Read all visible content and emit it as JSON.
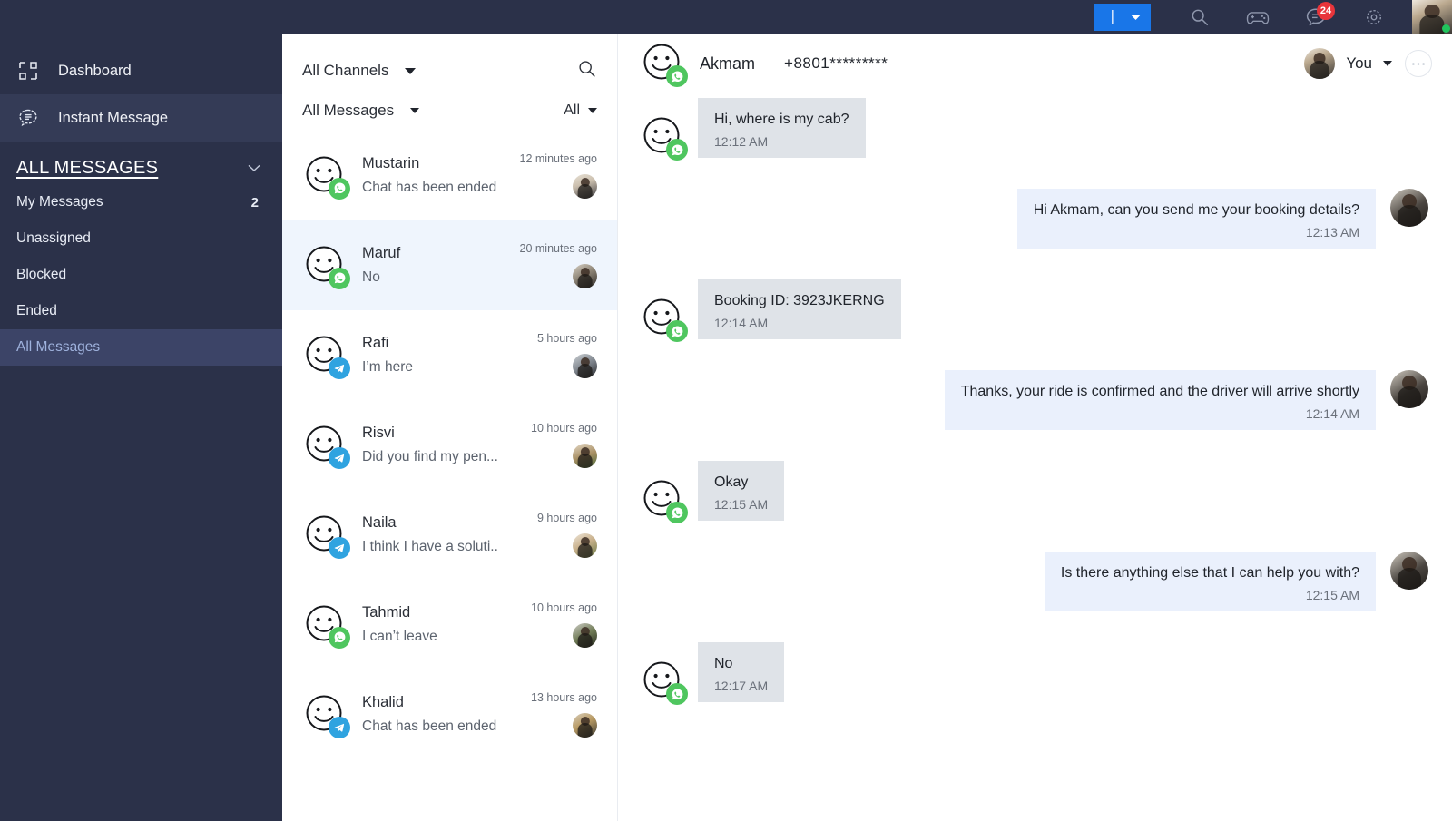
{
  "topbar": {
    "compose_button_label": "",
    "icons": [
      {
        "name": "search-icon",
        "glyph": "search"
      },
      {
        "name": "game-controller-icon",
        "glyph": "controller"
      },
      {
        "name": "messages-icon",
        "glyph": "chat",
        "badge": "24"
      },
      {
        "name": "settings-gear-icon",
        "glyph": "gear"
      }
    ],
    "badge_count": "24",
    "accent_color": "#1976e8",
    "bar_color": "#2b3149",
    "badge_color": "#e8353b",
    "status": "online"
  },
  "sidebar": {
    "items": [
      {
        "label": "Dashboard",
        "icon": "dashboard-grid-icon",
        "active": false
      },
      {
        "label": "Instant Message",
        "icon": "chat-bubble-icon",
        "active": true
      }
    ],
    "section": {
      "title": "ALL MESSAGES",
      "collapse_icon": "chevron-down-icon",
      "items": [
        {
          "label": "My Messages",
          "count": "2",
          "active": false
        },
        {
          "label": "Unassigned",
          "count": "",
          "active": false
        },
        {
          "label": "Blocked",
          "count": "",
          "active": false
        },
        {
          "label": "Ended",
          "count": "",
          "active": false
        },
        {
          "label": "All Messages",
          "count": "",
          "active": true
        }
      ]
    }
  },
  "chatlist": {
    "channel_filter": "All Channels",
    "search_icon": "search-icon",
    "message_filter": "All Messages",
    "status_filter": "All",
    "conversations": [
      {
        "name": "Mustarin",
        "preview": "Chat has been ended",
        "time": "12 minutes ago",
        "channel": "whatsapp",
        "selected": false,
        "agent_class": "ph-a"
      },
      {
        "name": "Maruf",
        "preview": "No",
        "time": "20 minutes ago",
        "channel": "whatsapp",
        "selected": true,
        "agent_class": "ph-b"
      },
      {
        "name": "Rafi",
        "preview": "I’m here",
        "time": "5 hours ago",
        "channel": "telegram",
        "selected": false,
        "agent_class": "ph-c"
      },
      {
        "name": "Risvi",
        "preview": "Did you find my pen...",
        "time": "10 hours ago",
        "channel": "telegram",
        "selected": false,
        "agent_class": "ph-d"
      },
      {
        "name": "Naila",
        "preview": "I think I have a soluti..",
        "time": "9 hours ago",
        "channel": "telegram",
        "selected": false,
        "agent_class": "ph-e"
      },
      {
        "name": "Tahmid",
        "preview": "I can’t leave",
        "time": "10 hours ago",
        "channel": "whatsapp",
        "selected": false,
        "agent_class": "ph-f"
      },
      {
        "name": "Khalid",
        "preview": "Chat has been ended",
        "time": "13 hours ago",
        "channel": "telegram",
        "selected": false,
        "agent_class": "ph-g"
      }
    ]
  },
  "conversation": {
    "contact_name": "Akmam",
    "contact_phone": "+8801*********",
    "contact_channel": "whatsapp",
    "assigned_agent": "You",
    "agent_caret_icon": "chevron-down-icon",
    "more_icon": "ellipsis-icon",
    "messages": [
      {
        "direction": "in",
        "text": "Hi, where is my cab?",
        "time": "12:12 AM",
        "channel": "whatsapp"
      },
      {
        "direction": "out",
        "text": "Hi Akmam, can you send me your booking details?",
        "time": "12:13 AM"
      },
      {
        "direction": "in",
        "text": "Booking ID: 3923JKERNG",
        "time": "12:14 AM",
        "channel": "whatsapp"
      },
      {
        "direction": "out",
        "text": "Thanks, your ride is confirmed and the driver will arrive shortly",
        "time": "12:14 AM"
      },
      {
        "direction": "in",
        "text": "Okay",
        "time": "12:15 AM",
        "channel": "whatsapp"
      },
      {
        "direction": "out",
        "text": "Is there anything else that I can help you with?",
        "time": "12:15 AM"
      },
      {
        "direction": "in",
        "text": "No",
        "time": "12:17 AM",
        "channel": "whatsapp"
      }
    ]
  },
  "colors": {
    "incoming_bubble": "#dfe3e8",
    "outgoing_bubble": "#eaf0fc",
    "whatsapp_green": "#4fc65f",
    "telegram_blue": "#2fa3e0",
    "selected_row": "#eff5fd"
  }
}
